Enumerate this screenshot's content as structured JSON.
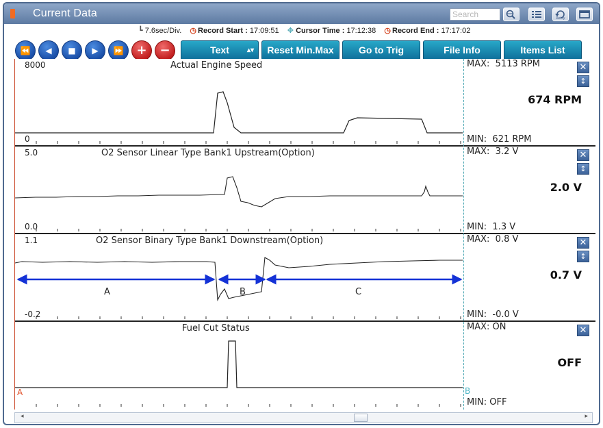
{
  "window": {
    "title": "Current Data",
    "search_placeholder": "Search",
    "retry_label": "Retry"
  },
  "info": {
    "division": "7.6sec/Div.",
    "record_start_label": "Record Start :",
    "record_start": "17:09:51",
    "cursor_time_label": "Cursor Time :",
    "cursor_time": "17:12:38",
    "record_end_label": "Record End :",
    "record_end": "17:17:02"
  },
  "toolbar": {
    "text_select": "Text",
    "reset_minmax": "Reset Min.Max",
    "goto_trig": "Go to Trig",
    "file_info": "File Info",
    "items_list": "Items List"
  },
  "panels": [
    {
      "name": "Actual Engine Speed",
      "axis_max": "8000",
      "axis_min": "0",
      "max_label": "MAX:",
      "max_value": "5113 RPM",
      "min_label": "MIN:",
      "min_value": "621 RPM",
      "current": "674 RPM"
    },
    {
      "name": "O2 Sensor Linear Type Bank1 Upstream(Option)",
      "axis_max": "5.0",
      "axis_min": "0.0",
      "max_label": "MAX:",
      "max_value": "3.2 V",
      "min_label": "MIN:",
      "min_value": "1.3 V",
      "current": "2.0 V"
    },
    {
      "name": "O2 Sensor Binary Type Bank1 Downstream(Option)",
      "axis_max": "1.1",
      "axis_min": "-0.2",
      "max_label": "MAX:",
      "max_value": "0.8 V",
      "min_label": "MIN:",
      "min_value": "-0.0 V",
      "current": "0.7 V",
      "region_labels": [
        "A",
        "B",
        "C"
      ]
    },
    {
      "name": "Fuel Cut Status",
      "max_label": "MAX:",
      "max_value": "ON",
      "min_label": "MIN:",
      "min_value": "OFF",
      "current": "OFF"
    }
  ],
  "cursors": {
    "a": "A",
    "b": "B"
  },
  "colors": {
    "accent_blue": "#1a4fa8",
    "teal_button": "#0f6f9a",
    "region_arrow": "#1432d6",
    "cursor_a": "#e2522b",
    "cursor_b": "#4db6c6"
  }
}
